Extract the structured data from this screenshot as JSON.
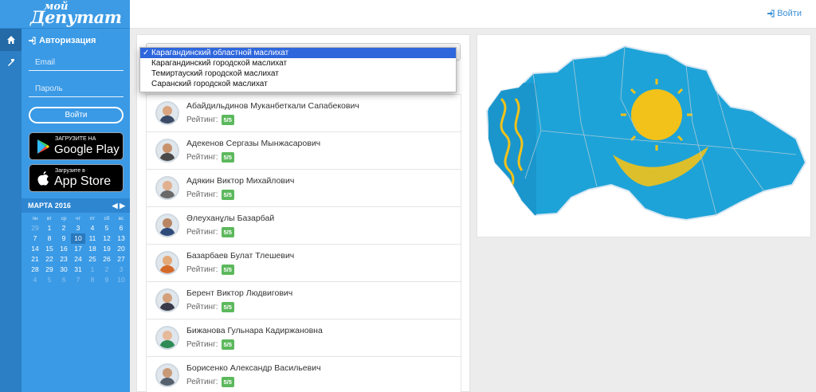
{
  "brand": {
    "logo_line1": "мой",
    "logo_line2": "Депутат"
  },
  "topbar": {
    "login_label": "Войти"
  },
  "sidebar": {
    "auth_title": "Авторизация",
    "email_placeholder": "Email",
    "password_placeholder": "Пароль",
    "login_button": "Войти",
    "google_play": {
      "small": "ЗАГРУЗИТЕ НА",
      "big": "Google Play"
    },
    "app_store": {
      "small": "Загрузите в",
      "big": "App Store"
    }
  },
  "calendar": {
    "month_label": "МАРТА 2016",
    "weekdays": [
      "пн",
      "вт",
      "ср",
      "чт",
      "пт",
      "сб",
      "вс"
    ],
    "days": [
      [
        "29",
        "1",
        "2",
        "3",
        "4",
        "5",
        "6"
      ],
      [
        "7",
        "8",
        "9",
        "10",
        "11",
        "12",
        "13"
      ],
      [
        "14",
        "15",
        "16",
        "17",
        "18",
        "19",
        "20"
      ],
      [
        "21",
        "22",
        "23",
        "24",
        "25",
        "26",
        "27"
      ],
      [
        "28",
        "29",
        "30",
        "31",
        "1",
        "2",
        "3"
      ],
      [
        "4",
        "5",
        "6",
        "7",
        "8",
        "9",
        "10"
      ]
    ],
    "today": "10"
  },
  "council_select": {
    "options": [
      "Карагандинский областной маслихат",
      "Карагандинский городской маслихат",
      "Темиртауский городской маслихат",
      "Саранский городской маслихат"
    ],
    "selected_index": 0
  },
  "deputies": {
    "rating_label": "Рейтинг:",
    "items": [
      {
        "name": "Абайдильдинов Муканбеткали Сапабекович",
        "rating": "5/5"
      },
      {
        "name": "Адекенов Сергазы Мынжасарович",
        "rating": "5/5"
      },
      {
        "name": "Адякин Виктор Михайлович",
        "rating": "5/5"
      },
      {
        "name": "Әлеуханұлы Базарбай",
        "rating": "5/5"
      },
      {
        "name": "Базарбаев Булат Тлешевич",
        "rating": "5/5"
      },
      {
        "name": "Берент Виктор Людвигович",
        "rating": "5/5"
      },
      {
        "name": "Бижанова Гульнара Кадиржановна",
        "rating": "5/5"
      },
      {
        "name": "Борисенко Александр Васильевич",
        "rating": "5/5"
      }
    ]
  },
  "colors": {
    "sidebar": "#3a9ae6",
    "accent": "#2e66dc",
    "badge": "#5cb85c",
    "map_blue": "#1ea3d8",
    "map_gold": "#f2c21a"
  }
}
